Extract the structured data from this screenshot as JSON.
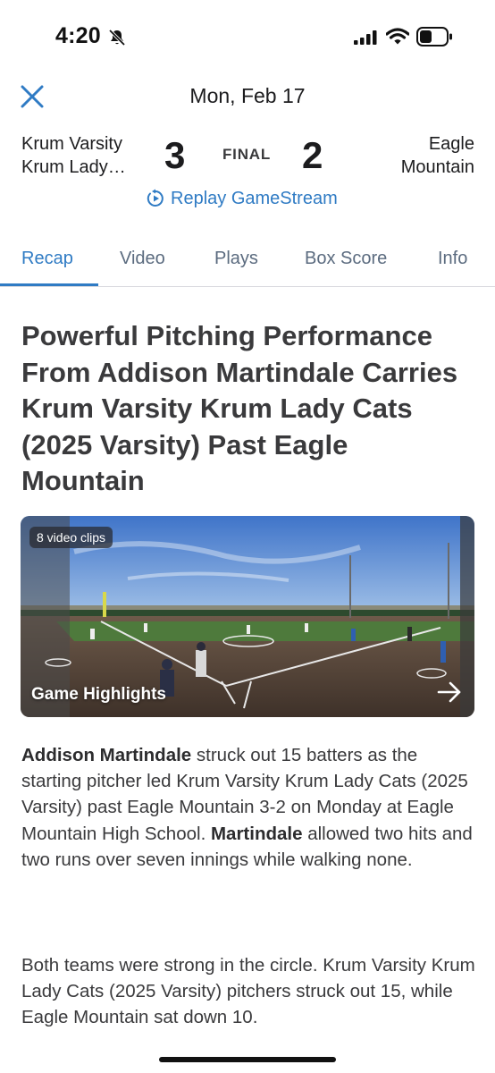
{
  "status_bar": {
    "time": "4:20"
  },
  "header": {
    "date": "Mon, Feb 17"
  },
  "scoreboard": {
    "home_team_line1": "Krum Varsity",
    "home_team_line2": "Krum Lady…",
    "home_score": "3",
    "status": "FINAL",
    "away_score": "2",
    "away_team_line1": "Eagle",
    "away_team_line2": "Mountain",
    "replay_label": "Replay GameStream"
  },
  "tabs": [
    {
      "label": "Recap",
      "active": true
    },
    {
      "label": "Video",
      "active": false
    },
    {
      "label": "Plays",
      "active": false
    },
    {
      "label": "Box Score",
      "active": false
    },
    {
      "label": "Info",
      "active": false
    }
  ],
  "article": {
    "headline": "Powerful Pitching Performance From Addison Martindale Carries Krum Varsity Krum Lady Cats (2025 Varsity) Past Eagle Mountain",
    "video": {
      "clips_badge": "8 video clips",
      "label": "Game Highlights"
    },
    "paragraph1": {
      "name1": "Addison Martindale",
      "text1": " struck out 15 batters as the starting pitcher led Krum Varsity Krum Lady Cats (2025 Varsity) past Eagle Mountain 3-2 on Monday at Eagle Mountain High School. ",
      "name2": "Martindale",
      "text2": " allowed two hits and two runs over seven innings while walking none."
    },
    "paragraph2": "Both teams were strong in the circle. Krum Varsity Krum Lady Cats (2025 Varsity) pitchers struck out 15, while Eagle Mountain sat down 10."
  },
  "colors": {
    "accent": "#2f7bc4",
    "text": "#3a3a3c"
  }
}
